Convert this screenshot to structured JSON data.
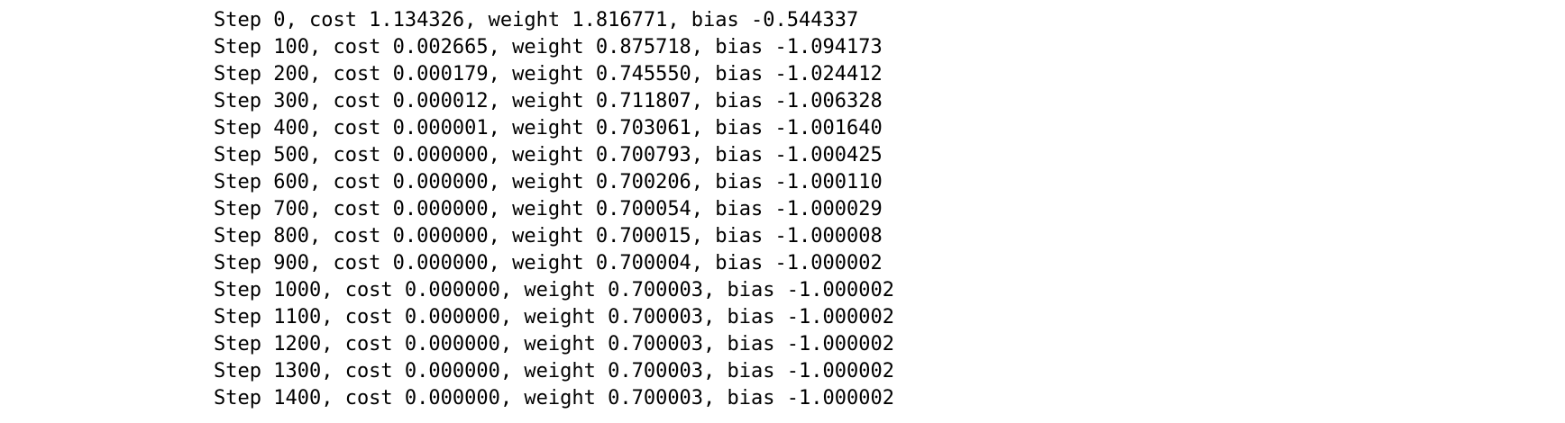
{
  "output": {
    "lines": [
      "Step 0, cost 1.134326, weight 1.816771, bias -0.544337",
      "Step 100, cost 0.002665, weight 0.875718, bias -1.094173",
      "Step 200, cost 0.000179, weight 0.745550, bias -1.024412",
      "Step 300, cost 0.000012, weight 0.711807, bias -1.006328",
      "Step 400, cost 0.000001, weight 0.703061, bias -1.001640",
      "Step 500, cost 0.000000, weight 0.700793, bias -1.000425",
      "Step 600, cost 0.000000, weight 0.700206, bias -1.000110",
      "Step 700, cost 0.000000, weight 0.700054, bias -1.000029",
      "Step 800, cost 0.000000, weight 0.700015, bias -1.000008",
      "Step 900, cost 0.000000, weight 0.700004, bias -1.000002",
      "Step 1000, cost 0.000000, weight 0.700003, bias -1.000002",
      "Step 1100, cost 0.000000, weight 0.700003, bias -1.000002",
      "Step 1200, cost 0.000000, weight 0.700003, bias -1.000002",
      "Step 1300, cost 0.000000, weight 0.700003, bias -1.000002",
      "Step 1400, cost 0.000000, weight 0.700003, bias -1.000002"
    ]
  }
}
